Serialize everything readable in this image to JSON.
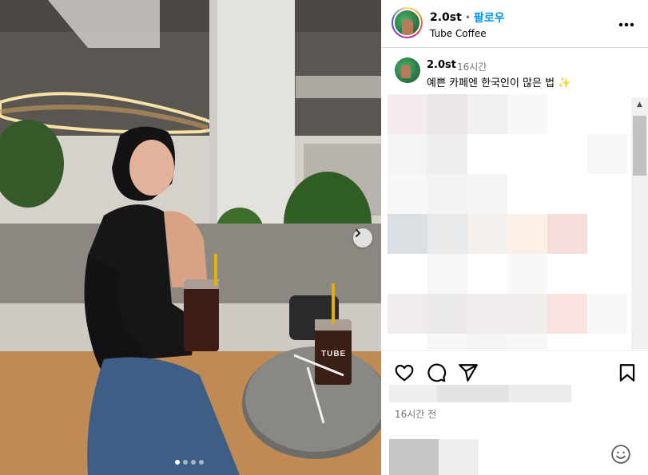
{
  "post": {
    "username": "2.0st",
    "follow_label": "팔로우",
    "location": "Tube Coffee",
    "more_label": "•••"
  },
  "caption": {
    "username": "2.0st",
    "time": "16시간",
    "text": "예쁜 카페엔 한국인이 많은 법 ✨"
  },
  "footer": {
    "time": "16시간 전"
  },
  "photo": {
    "cup_brand": "TUBE",
    "carousel_count": 4,
    "carousel_active": 1
  },
  "colors": {
    "follow": "#0095f6",
    "muted": "#737373",
    "border": "#dbdbdb"
  },
  "icons": [
    "chevron-right-icon",
    "heart-icon",
    "comment-icon",
    "share-icon",
    "bookmark-icon",
    "emoji-icon",
    "more-icon"
  ]
}
